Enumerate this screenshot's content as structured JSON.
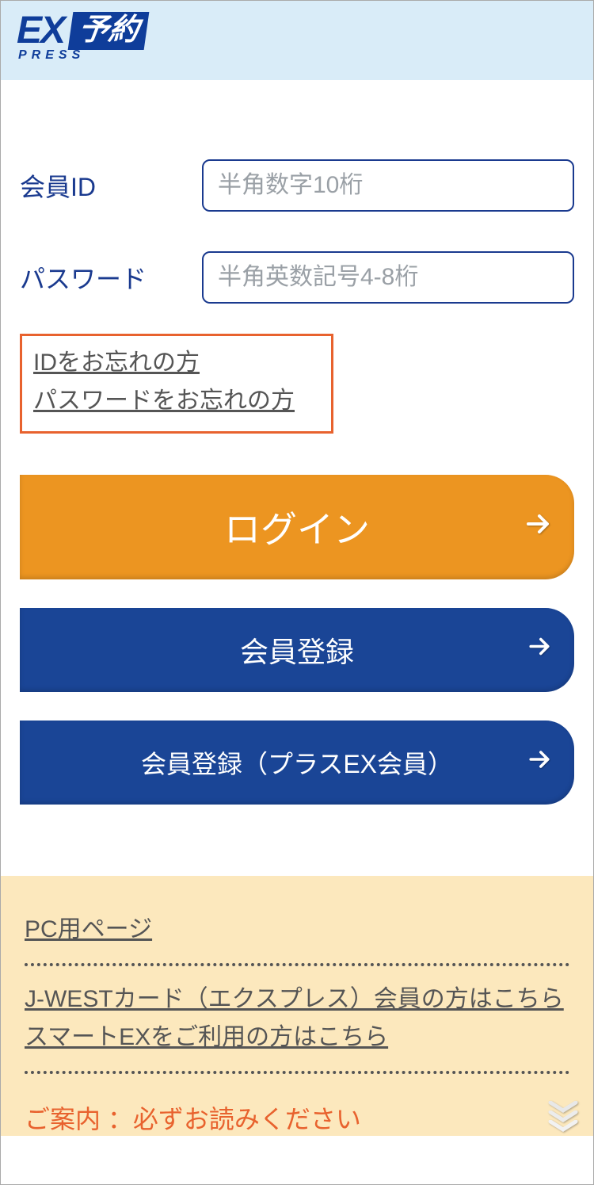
{
  "logo": {
    "ex": "EX",
    "box": "予約",
    "press": "PRESS"
  },
  "form": {
    "id_label": "会員ID",
    "id_placeholder": "半角数字10桁",
    "pw_label": "パスワード",
    "pw_placeholder": "半角英数記号4-8桁"
  },
  "forgot": {
    "id": "IDをお忘れの方",
    "pw": "パスワードをお忘れの方"
  },
  "buttons": {
    "login": "ログイン",
    "register": "会員登録",
    "register_plus": "会員登録（プラスEX会員）"
  },
  "footer": {
    "pc": "PC用ページ",
    "jwest": "J-WESTカード（エクスプレス）会員の方はこちら",
    "smartex": "スマートEXをご利用の方はこちら",
    "notice": "ご案内 ：必ずお読みください"
  }
}
